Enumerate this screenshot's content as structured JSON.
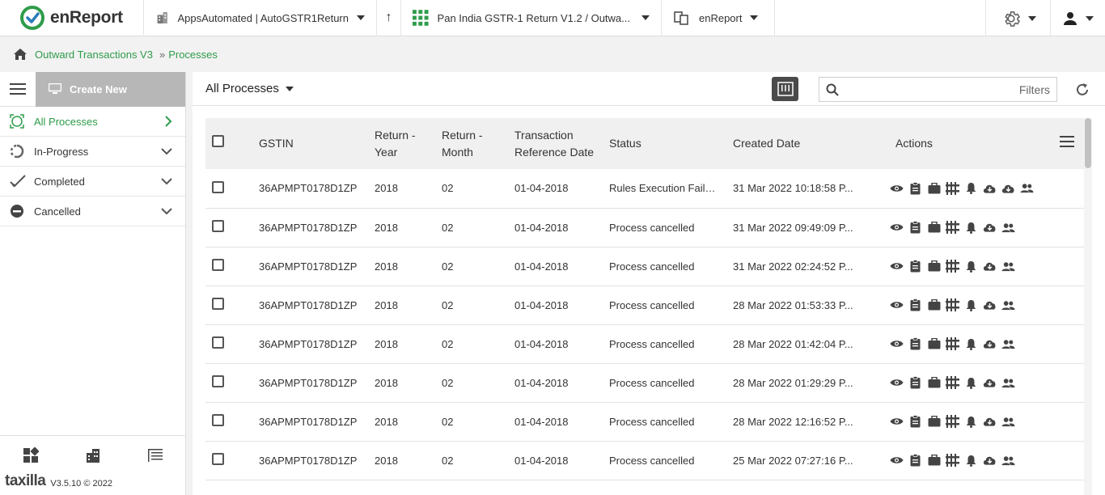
{
  "app": {
    "logo_text": "enReport"
  },
  "topbar": {
    "app_selector": "AppsAutomated | AutoGSTR1Return",
    "process_selector": "Pan India GSTR-1 Return V1.2 / Outwa...",
    "report_selector": "enReport"
  },
  "breadcrumb": {
    "items": [
      "Outward Transactions V3",
      "Processes"
    ]
  },
  "sidebar": {
    "create_label": "Create New",
    "items": [
      {
        "label": "All Processes"
      },
      {
        "label": "In-Progress"
      },
      {
        "label": "Completed"
      },
      {
        "label": "Cancelled"
      }
    ],
    "footer": {
      "brand": "taxilla",
      "version": "V3.5.10 © 2022"
    }
  },
  "main": {
    "view_title": "All Processes",
    "search_placeholder": "",
    "filters_label": "Filters",
    "columns": {
      "gstin": "GSTIN",
      "return_year": "Return - Year",
      "return_month": "Return - Month",
      "txn_ref_date": "Transaction Reference Date",
      "status": "Status",
      "created_date": "Created Date",
      "actions": "Actions"
    },
    "rows": [
      {
        "gstin": "36APMPT0178D1ZP",
        "year": "2018",
        "month": "02",
        "ref_date": "01-04-2018",
        "status": "Rules Execution Failure",
        "created": "31 Mar 2022 10:18:58 P...",
        "extra_download": true
      },
      {
        "gstin": "36APMPT0178D1ZP",
        "year": "2018",
        "month": "02",
        "ref_date": "01-04-2018",
        "status": "Process cancelled",
        "created": "31 Mar 2022 09:49:09 P...",
        "extra_download": false
      },
      {
        "gstin": "36APMPT0178D1ZP",
        "year": "2018",
        "month": "02",
        "ref_date": "01-04-2018",
        "status": "Process cancelled",
        "created": "31 Mar 2022 02:24:52 P...",
        "extra_download": false
      },
      {
        "gstin": "36APMPT0178D1ZP",
        "year": "2018",
        "month": "02",
        "ref_date": "01-04-2018",
        "status": "Process cancelled",
        "created": "28 Mar 2022 01:53:33 P...",
        "extra_download": false
      },
      {
        "gstin": "36APMPT0178D1ZP",
        "year": "2018",
        "month": "02",
        "ref_date": "01-04-2018",
        "status": "Process cancelled",
        "created": "28 Mar 2022 01:42:04 P...",
        "extra_download": false
      },
      {
        "gstin": "36APMPT0178D1ZP",
        "year": "2018",
        "month": "02",
        "ref_date": "01-04-2018",
        "status": "Process cancelled",
        "created": "28 Mar 2022 01:29:29 P...",
        "extra_download": false
      },
      {
        "gstin": "36APMPT0178D1ZP",
        "year": "2018",
        "month": "02",
        "ref_date": "01-04-2018",
        "status": "Process cancelled",
        "created": "28 Mar 2022 12:16:52 P...",
        "extra_download": false
      },
      {
        "gstin": "36APMPT0178D1ZP",
        "year": "2018",
        "month": "02",
        "ref_date": "01-04-2018",
        "status": "Process cancelled",
        "created": "25 Mar 2022 07:27:16 P...",
        "extra_download": false
      }
    ]
  },
  "colors": {
    "accent": "#2e9c4a",
    "button_gray": "#b7b7b7",
    "dark_btn": "#4a4a4a"
  },
  "icons": [
    "home-icon",
    "menu-icon",
    "monitor-icon",
    "eye-icon",
    "clipboard-icon",
    "briefcase-icon",
    "grid-icon",
    "bell-icon",
    "cloud-download-icon",
    "users-icon",
    "gear-icon",
    "user-icon",
    "refresh-icon",
    "search-icon"
  ]
}
